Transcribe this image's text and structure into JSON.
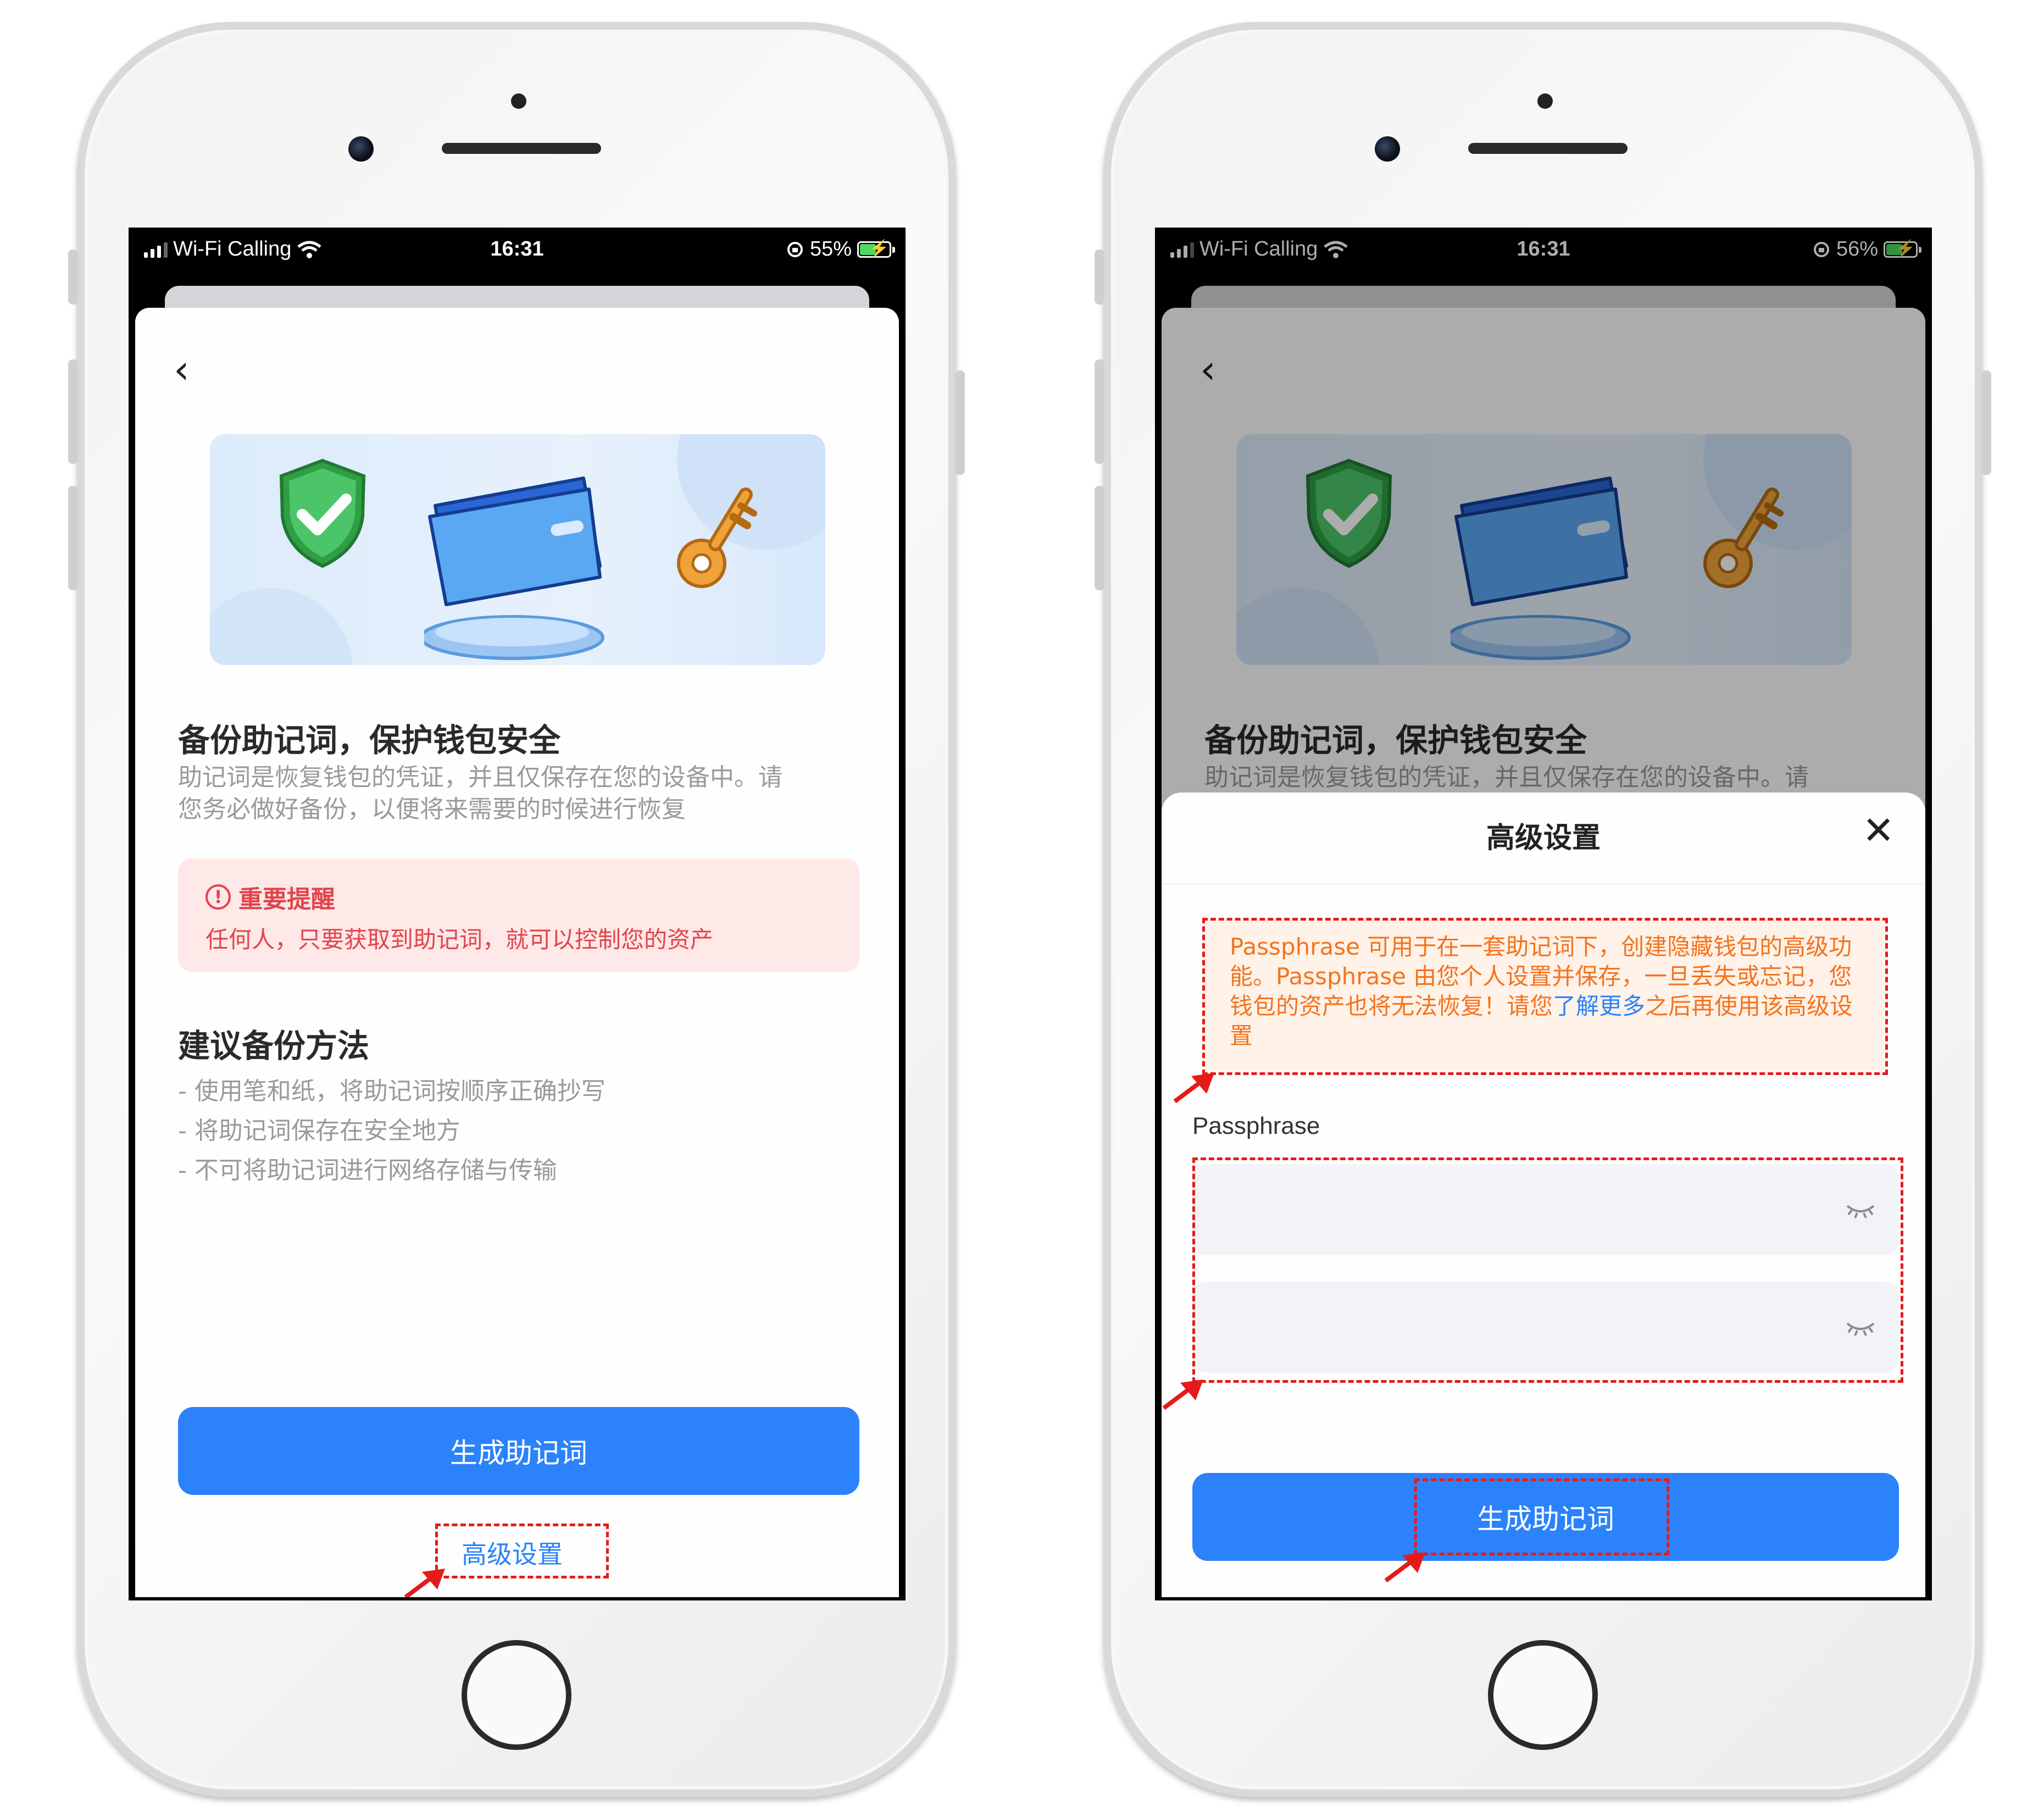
{
  "status_left": {
    "carrier": "Wi-Fi Calling",
    "time": "16:31",
    "battery": "55%",
    "battery_level": 0.55
  },
  "status_right": {
    "carrier": "Wi-Fi Calling",
    "time": "16:31",
    "battery": "56%",
    "battery_level": 0.56
  },
  "backup": {
    "title": "备份助记词，保护钱包安全",
    "desc_line1": "助记词是恢复钱包的凭证，并且仅保存在您的设备中。请",
    "desc_line2": "您务必做好备份，以便将来需要的时候进行恢复",
    "alert_title": "重要提醒",
    "alert_text": "任何人，只要获取到助记词，就可以控制您的资产",
    "tips_title": "建议备份方法",
    "tips": [
      "- 使用笔和纸，将助记词按顺序正确抄写",
      "- 将助记词保存在安全地方",
      "- 不可将助记词进行网络存储与传输"
    ],
    "generate_button": "生成助记词",
    "advanced_link": "高级设置"
  },
  "modal": {
    "title": "高级设置",
    "warn_part1": "Passphrase 可用于在一套助记词下，创建隐藏钱包的高级功能。Passphrase 由您个人设置并保存，一旦丢失或忘记，您钱包的资产也将无法恢复！请您",
    "warn_link": "了解更多",
    "warn_part2": "之后再使用该高级设置",
    "field_label": "Passphrase",
    "generate_button": "生成助记词"
  },
  "colors": {
    "primary": "#2b82fb",
    "alert_red": "#e0454a",
    "warn_orange": "#f4731d",
    "annotation_red": "#e51b1b"
  },
  "icons": [
    "back-chevron-icon",
    "shield-check-icon",
    "wallet-icon",
    "key-icon",
    "alert-circle-icon",
    "close-icon",
    "eye-closed-icon",
    "wifi-icon",
    "signal-icon",
    "battery-icon",
    "orientation-lock-icon"
  ]
}
